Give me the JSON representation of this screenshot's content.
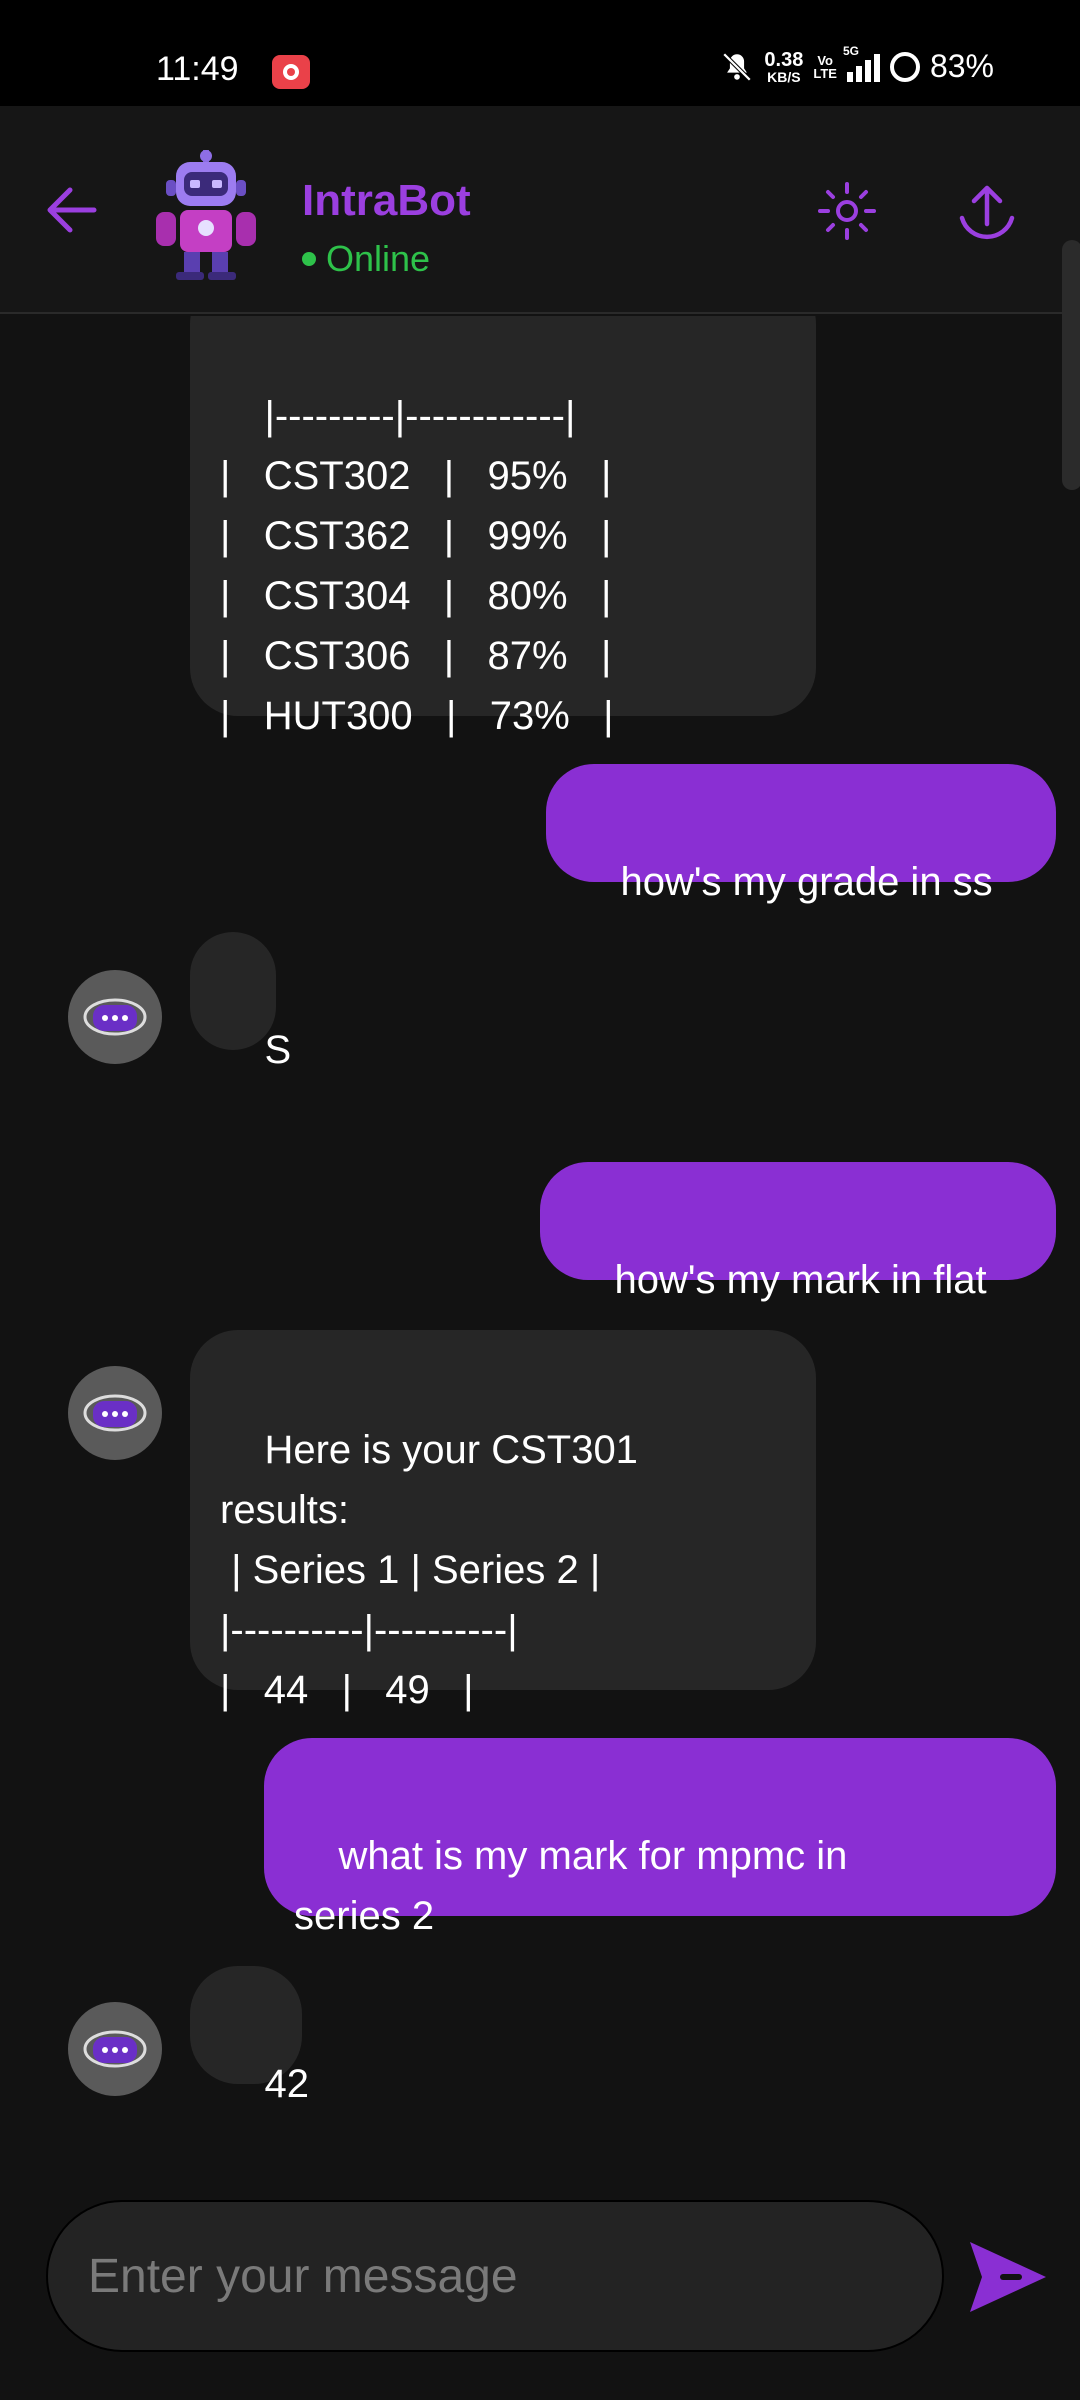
{
  "status_bar": {
    "time": "11:49",
    "net_speed_value": "0.38",
    "net_speed_unit": "KB/S",
    "volte_top": "Vo",
    "volte_bottom": "LTE",
    "network_type": "5G",
    "battery": "83%"
  },
  "header": {
    "bot_name": "IntraBot",
    "status": "Online",
    "status_color": "#2ec24a",
    "accent_color": "#9b3fe0"
  },
  "messages": [
    {
      "sender": "bot",
      "text": "|---------|------------|\n|   CST302   |   95%   |\n|   CST362   |   99%   |\n|   CST304   |   80%   |\n|   CST306   |   87%   |\n|   HUT300   |   73%   |"
    },
    {
      "sender": "user",
      "text": "how's my grade in ss"
    },
    {
      "sender": "bot",
      "text": "S"
    },
    {
      "sender": "user",
      "text": "how's my mark in flat"
    },
    {
      "sender": "bot",
      "text": "Here is your CST301\nresults:\n | Series 1 | Series 2 |\n|----------|----------|\n|   44   |   49   |"
    },
    {
      "sender": "user",
      "text": "what is my mark for mpmc in\nseries 2"
    },
    {
      "sender": "bot",
      "text": "42"
    }
  ],
  "composer": {
    "placeholder": "Enter your message",
    "send_color": "#8a2fd3"
  }
}
